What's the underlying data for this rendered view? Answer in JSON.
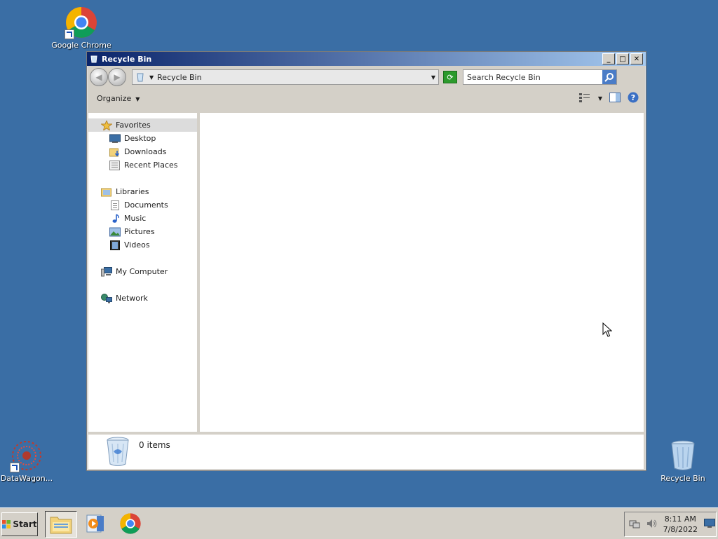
{
  "desktop": {
    "icons": [
      {
        "label": "Google Chrome"
      },
      {
        "label": "DataWagon..."
      },
      {
        "label": "Recycle Bin"
      }
    ]
  },
  "window": {
    "title": "Recycle Bin",
    "controls": {
      "minimize": "_",
      "maximize": "□",
      "close": "✕"
    },
    "address": {
      "text": "Recycle Bin"
    },
    "search": {
      "placeholder": "Search Recycle Bin"
    },
    "toolbar": {
      "organize": "Organize"
    },
    "nav": {
      "favorites": {
        "label": "Favorites",
        "items": [
          {
            "label": "Desktop"
          },
          {
            "label": "Downloads"
          },
          {
            "label": "Recent Places"
          }
        ]
      },
      "libraries": {
        "label": "Libraries",
        "items": [
          {
            "label": "Documents"
          },
          {
            "label": "Music"
          },
          {
            "label": "Pictures"
          },
          {
            "label": "Videos"
          }
        ]
      },
      "computer": {
        "label": "My Computer"
      },
      "network": {
        "label": "Network"
      }
    },
    "details": {
      "count": "0 items"
    }
  },
  "taskbar": {
    "start": "Start",
    "clock": {
      "time": "8:11 AM",
      "date": "7/8/2022"
    }
  },
  "colors": {
    "desktop": "#3a6ea5",
    "titlebar": "#0a246a",
    "chrome": "#d4d0c8"
  }
}
